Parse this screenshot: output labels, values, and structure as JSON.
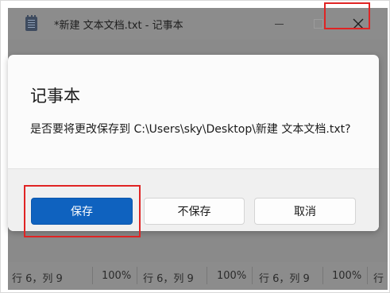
{
  "window": {
    "title": "*新建 文本文档.txt - 记事本",
    "icon": "notepad-icon"
  },
  "dialog": {
    "title": "记事本",
    "message": "是否要将更改保存到 C:\\Users\\sky\\Desktop\\新建 文本文档.txt?",
    "buttons": {
      "save": "保存",
      "dont_save": "不保存",
      "cancel": "取消"
    }
  },
  "statusbar": {
    "items": [
      "行 6，列 9",
      "100%",
      "行 6，列 9",
      "100%",
      "行 6，列 9",
      "100%",
      "行"
    ]
  },
  "colors": {
    "accent": "#0f62bf",
    "highlight": "#e02424"
  }
}
